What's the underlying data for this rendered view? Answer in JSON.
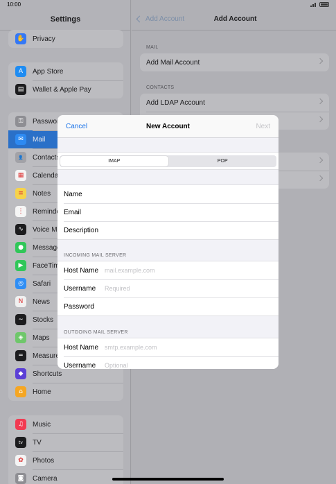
{
  "status": {
    "time": "10:00"
  },
  "sidebar": {
    "title": "Settings",
    "groups": [
      {
        "items": [
          {
            "label": "Privacy",
            "icon": "hand-icon",
            "color": "#3478f6",
            "glyph": "✋"
          }
        ]
      },
      {
        "items": [
          {
            "label": "App Store",
            "icon": "app-store-icon",
            "color": "#1e8cf2",
            "glyph": "A"
          },
          {
            "label": "Wallet & Apple Pay",
            "icon": "wallet-icon",
            "color": "#1c1c1e",
            "glyph": "▤"
          }
        ]
      },
      {
        "items": [
          {
            "label": "Passwords",
            "icon": "key-icon",
            "color": "#8e8e93",
            "glyph": "⚿"
          },
          {
            "label": "Mail",
            "icon": "mail-icon",
            "color": "#2d8af2",
            "glyph": "✉",
            "selected": true
          },
          {
            "label": "Contacts",
            "icon": "contacts-icon",
            "color": "#a2a2a7",
            "glyph": "👤"
          },
          {
            "label": "Calendar",
            "icon": "calendar-icon",
            "color": "#f4f4f4",
            "glyph": "▦"
          },
          {
            "label": "Notes",
            "icon": "notes-icon",
            "color": "#f6d34b",
            "glyph": "≡"
          },
          {
            "label": "Reminders",
            "icon": "reminders-icon",
            "color": "#f5f5f5",
            "glyph": "⋮"
          },
          {
            "label": "Voice Memos",
            "icon": "voice-memos-icon",
            "color": "#1c1c1e",
            "glyph": "∿"
          },
          {
            "label": "Messages",
            "icon": "messages-icon",
            "color": "#31c759",
            "glyph": "●"
          },
          {
            "label": "FaceTime",
            "icon": "facetime-icon",
            "color": "#31c759",
            "glyph": "▶"
          },
          {
            "label": "Safari",
            "icon": "safari-icon",
            "color": "#2f8ef5",
            "glyph": "◎"
          },
          {
            "label": "News",
            "icon": "news-icon",
            "color": "#f0f0f0",
            "glyph": "N"
          },
          {
            "label": "Stocks",
            "icon": "stocks-icon",
            "color": "#1c1c1e",
            "glyph": "∼"
          },
          {
            "label": "Maps",
            "icon": "maps-icon",
            "color": "#6fc76b",
            "glyph": "◈"
          },
          {
            "label": "Measure",
            "icon": "measure-icon",
            "color": "#1c1c1e",
            "glyph": "═"
          },
          {
            "label": "Shortcuts",
            "icon": "shortcuts-icon",
            "color": "#5b3fd6",
            "glyph": "◆"
          },
          {
            "label": "Home",
            "icon": "home-icon",
            "color": "#f5a623",
            "glyph": "⌂"
          }
        ]
      },
      {
        "items": [
          {
            "label": "Music",
            "icon": "music-icon",
            "color": "#f23a52",
            "glyph": "♫"
          },
          {
            "label": "TV",
            "icon": "tv-icon",
            "color": "#1c1c1e",
            "glyph": "tv"
          },
          {
            "label": "Photos",
            "icon": "photos-icon",
            "color": "#f4f4f4",
            "glyph": "✿"
          },
          {
            "label": "Camera",
            "icon": "camera-icon",
            "color": "#8e8e93",
            "glyph": "◙"
          }
        ]
      }
    ]
  },
  "detail": {
    "back_label": "Add Account",
    "title": "Add Account",
    "mail_section": "MAIL",
    "add_mail": "Add Mail Account",
    "contacts_section": "CONTACTS",
    "add_ldap": "Add LDAP Account"
  },
  "modal": {
    "cancel": "Cancel",
    "title": "New Account",
    "next": "Next",
    "segments": [
      "IMAP",
      "POP"
    ],
    "fields": [
      {
        "label": "Name",
        "placeholder": ""
      },
      {
        "label": "Email",
        "placeholder": ""
      },
      {
        "label": "Description",
        "placeholder": ""
      }
    ],
    "incoming_section": "INCOMING MAIL SERVER",
    "incoming": [
      {
        "label": "Host Name",
        "placeholder": "mail.example.com"
      },
      {
        "label": "Username",
        "placeholder": "Required"
      },
      {
        "label": "Password",
        "placeholder": ""
      }
    ],
    "outgoing_section": "OUTGOING MAIL SERVER",
    "outgoing": [
      {
        "label": "Host Name",
        "placeholder": "smtp.example.com"
      },
      {
        "label": "Username",
        "placeholder": "Optional"
      }
    ]
  }
}
